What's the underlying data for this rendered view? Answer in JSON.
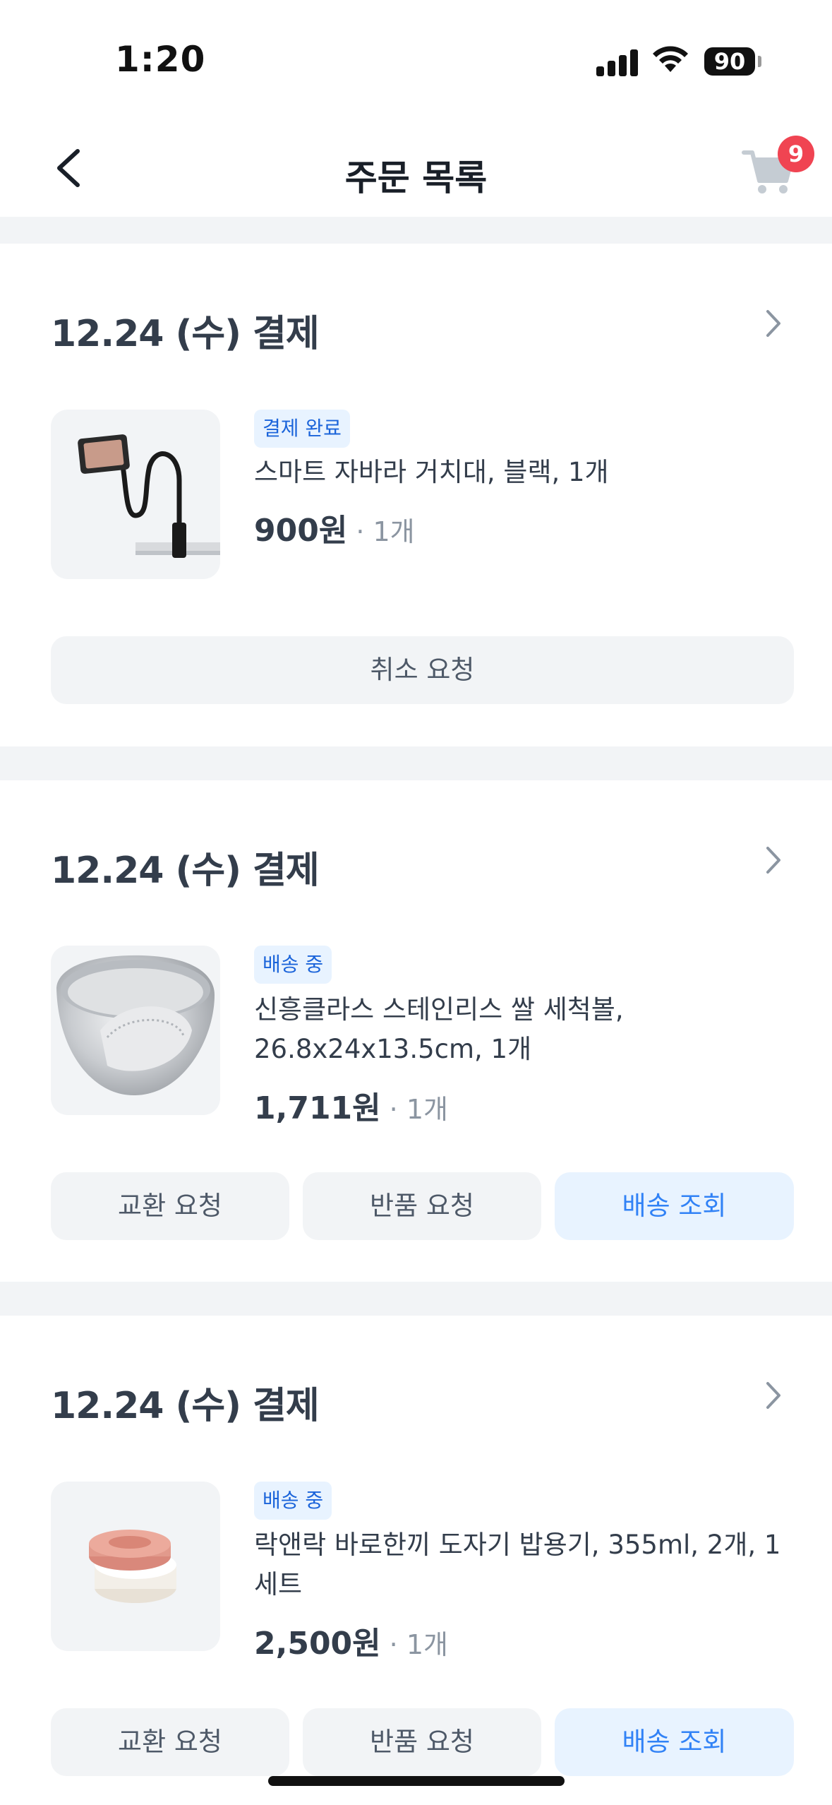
{
  "status_bar": {
    "time": "1:20",
    "battery": "90"
  },
  "header": {
    "title": "주문 목록",
    "cart_count": "9"
  },
  "orders": [
    {
      "date": "12.24 (수) 결제",
      "status": "결제 완료",
      "product": "스마트 자바라 거치대, 블랙, 1개",
      "price": "900원",
      "qty": "· 1개",
      "actions": [
        "취소 요청"
      ]
    },
    {
      "date": "12.24 (수) 결제",
      "status": "배송 중",
      "product": "신흥클라스 스테인리스 쌀 세척볼, 26.8x24x13.5cm, 1개",
      "price": "1,711원",
      "qty": "· 1개",
      "actions": [
        "교환 요청",
        "반품 요청",
        "배송 조회"
      ]
    },
    {
      "date": "12.24 (수) 결제",
      "status": "배송 중",
      "product": "락앤락 바로한끼 도자기 밥용기, 355ml, 2개, 1세트",
      "price": "2,500원",
      "qty": "· 1개",
      "actions": [
        "교환 요청",
        "반품 요청",
        "배송 조회"
      ]
    }
  ],
  "colors": {
    "accent": "#3182f6",
    "badge": "#f04452",
    "tag_bg": "#e8f3ff"
  },
  "icons": {
    "back": "chevron-left-icon",
    "cart": "cart-icon",
    "detail": "chevron-right-icon"
  }
}
